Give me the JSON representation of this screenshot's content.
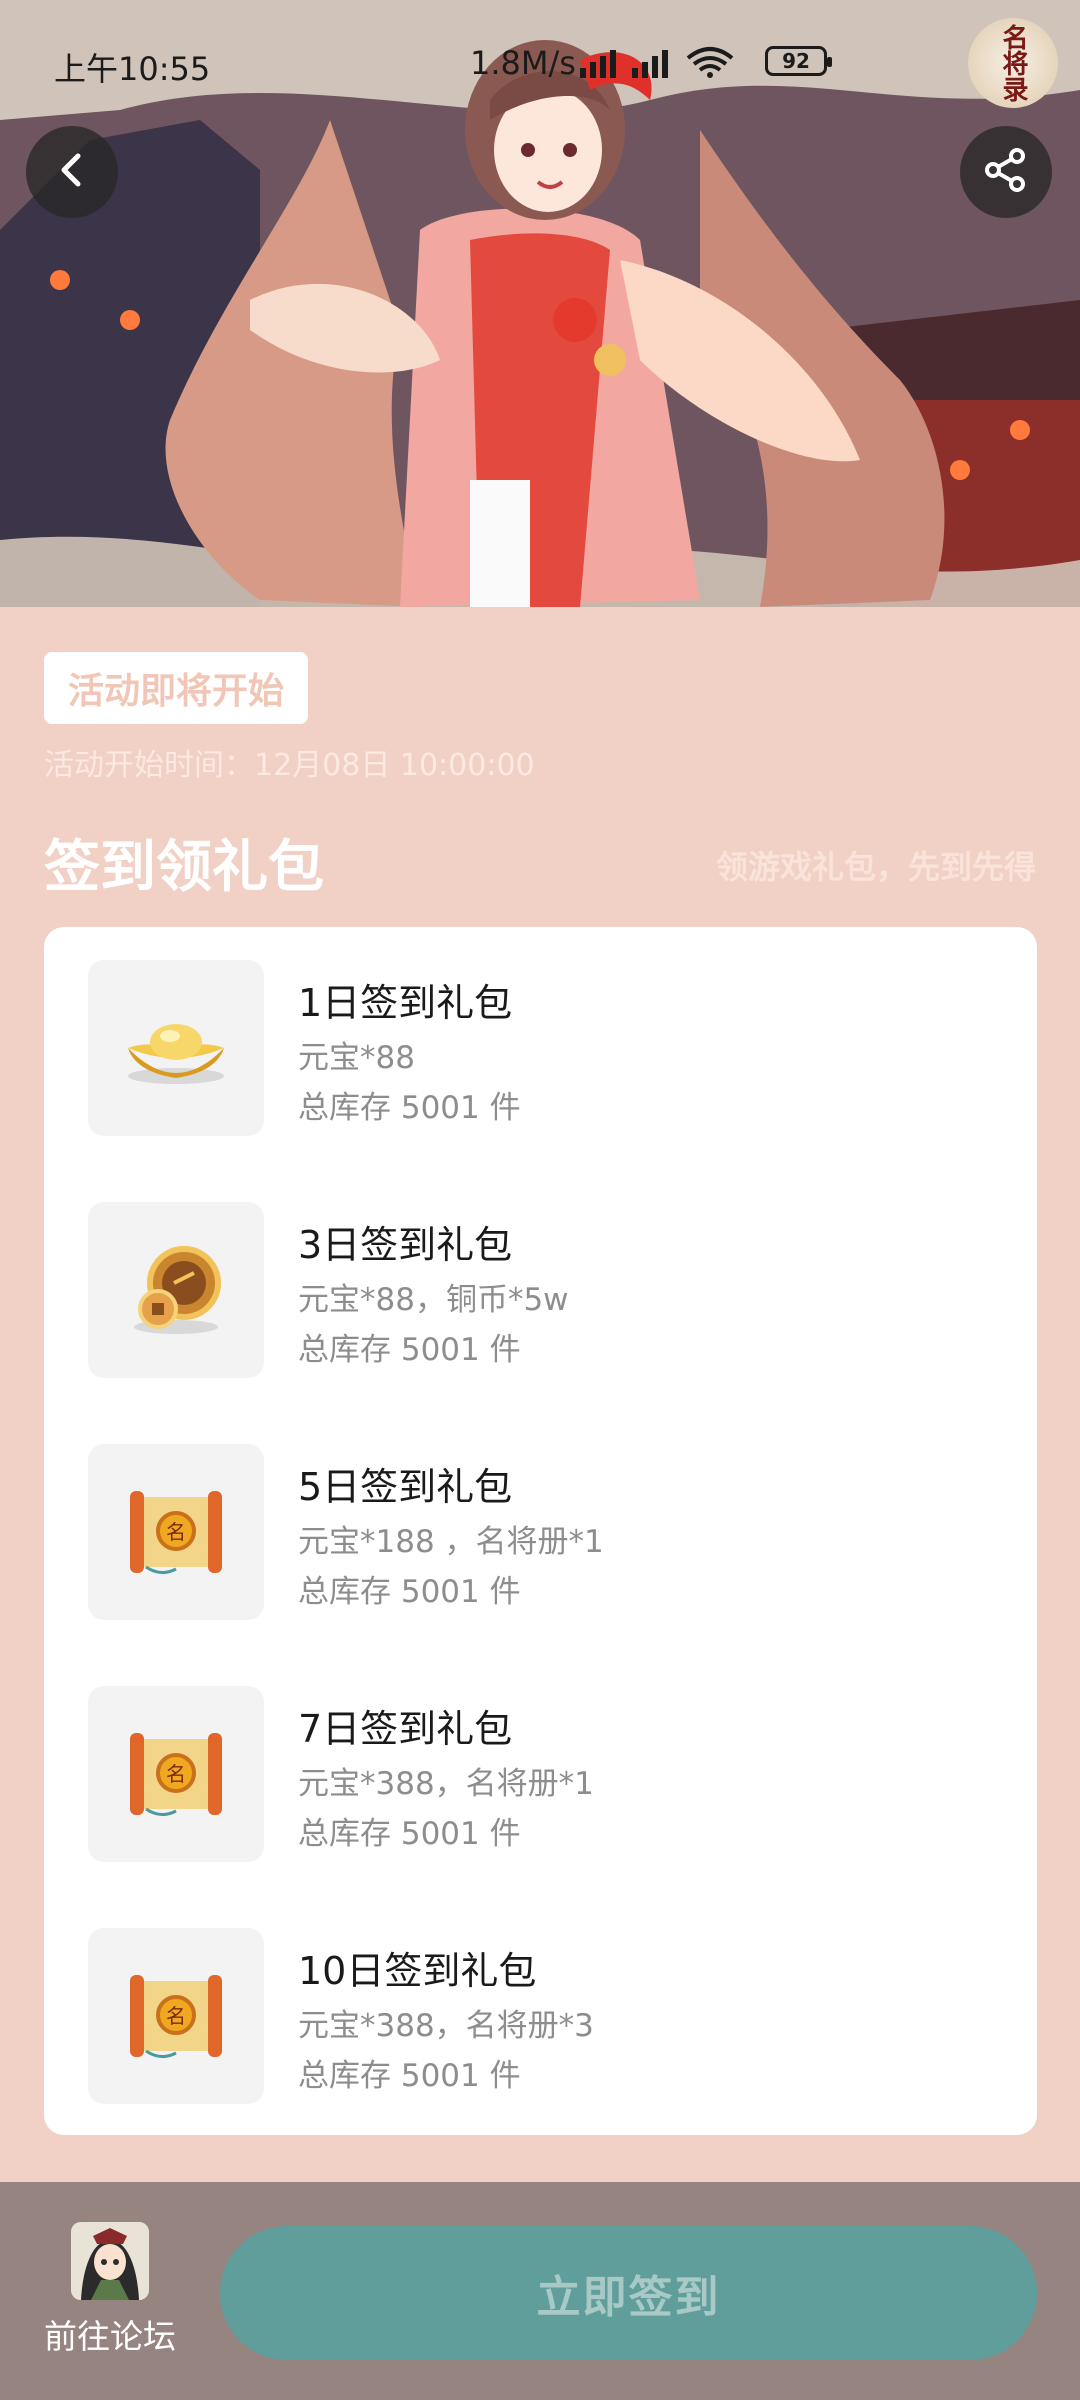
{
  "status_bar": {
    "time": "上午10:55",
    "speed": "1.8M/s",
    "battery": "92"
  },
  "header": {
    "logo_text": "名将录",
    "back_icon": "chevron-left-icon",
    "share_icon": "share-icon"
  },
  "event": {
    "badge": "活动即将开始",
    "start_time": "活动开始时间：12月08日 10:00:00"
  },
  "section": {
    "title": "签到领礼包",
    "subtitle": "领游戏礼包，先到先得"
  },
  "gifts": [
    {
      "name": "1日签到礼包",
      "desc": "元宝*88",
      "stock": "总库存 5001 件",
      "icon": "gold-ingot-icon"
    },
    {
      "name": "3日签到礼包",
      "desc": "元宝*88，铜币*5w",
      "stock": "总库存 5001 件",
      "icon": "copper-coin-icon"
    },
    {
      "name": "5日签到礼包",
      "desc": "元宝*188 ，名将册*1",
      "stock": "总库存 5001 件",
      "icon": "scroll-icon"
    },
    {
      "name": "7日签到礼包",
      "desc": "元宝*388，名将册*1",
      "stock": "总库存 5001 件",
      "icon": "scroll-icon"
    },
    {
      "name": "10日签到礼包",
      "desc": "元宝*388，名将册*3",
      "stock": "总库存 5001 件",
      "icon": "scroll-icon"
    }
  ],
  "bottom_bar": {
    "forum_label": "前往论坛",
    "signin_label": "立即签到"
  },
  "colors": {
    "page_bg": "#f1d1c5",
    "button_teal": "#5f9e9b",
    "bottom_bar": "#958480"
  }
}
